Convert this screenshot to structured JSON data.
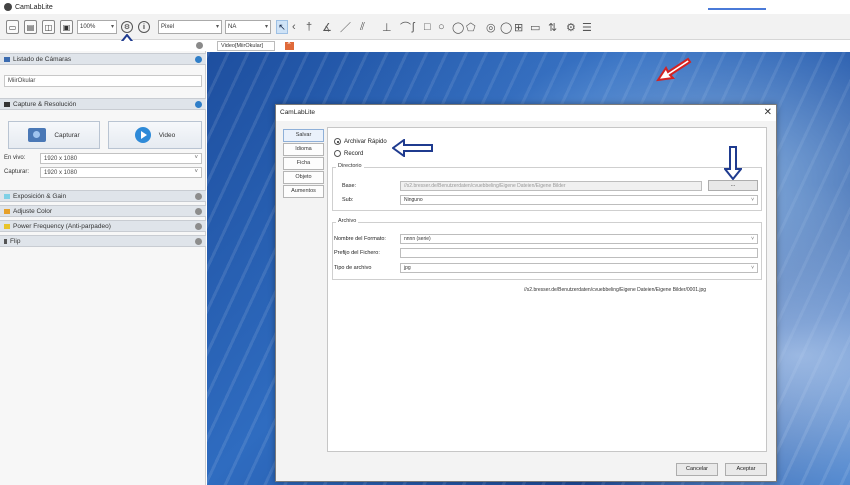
{
  "app": {
    "title": "CamLabLite"
  },
  "toolbar": {
    "zoom": "100%",
    "unit": "Pixel",
    "na": "NA"
  },
  "left_panel": {
    "camera_list_title": "Listado de Cámaras",
    "camera_item": "MiirOkular",
    "capture_title": "Capture & Resolución",
    "capture_button": "Capturar",
    "video_button": "Video",
    "live_label": "En vivo:",
    "live_value": "1920 x 1080",
    "capture_label": "Capturar:",
    "capture_value": "1920 x 1080",
    "sections": [
      "Exposición & Gain",
      "Adjuste Color",
      "Power Frequency (Anti-parpadeo)",
      "Flip"
    ]
  },
  "video": {
    "tab_label": "Video[MiirOkular]"
  },
  "dialog": {
    "title": "CamLabLite",
    "nav": [
      "Salvar",
      "Idioma",
      "Ficha",
      "Objeto",
      "Aumentos"
    ],
    "radio_quick": "Archivar Rápido",
    "radio_record": "Record",
    "directory_group": "Directorio",
    "base_label": "Base:",
    "base_value": "//s2.bresser.de/Benutzerdaten/cvuebbeling/Eigene Dateien/Eigene Bilder",
    "browse_label": "...",
    "sub_label": "Sub:",
    "sub_value": "Ninguno",
    "file_group": "Archivo",
    "format_label": "Nombre del Formato:",
    "format_value": "nnnn (serie)",
    "prefix_label": "Prefijo del Fichero:",
    "prefix_value": "",
    "type_label": "Tipo de archivo",
    "type_value": "jpg",
    "path_preview": "//s2.bresser.de/Benutzerdaten/cvuebbeling/Eigene Dateien/Eigene Bilder/0001.jpg",
    "cancel": "Cancelar",
    "accept": "Aceptar"
  },
  "colors": {
    "annotation_blue": "#1f3b8f",
    "annotation_red": "#d42222",
    "accent": "#2f7ec8"
  }
}
